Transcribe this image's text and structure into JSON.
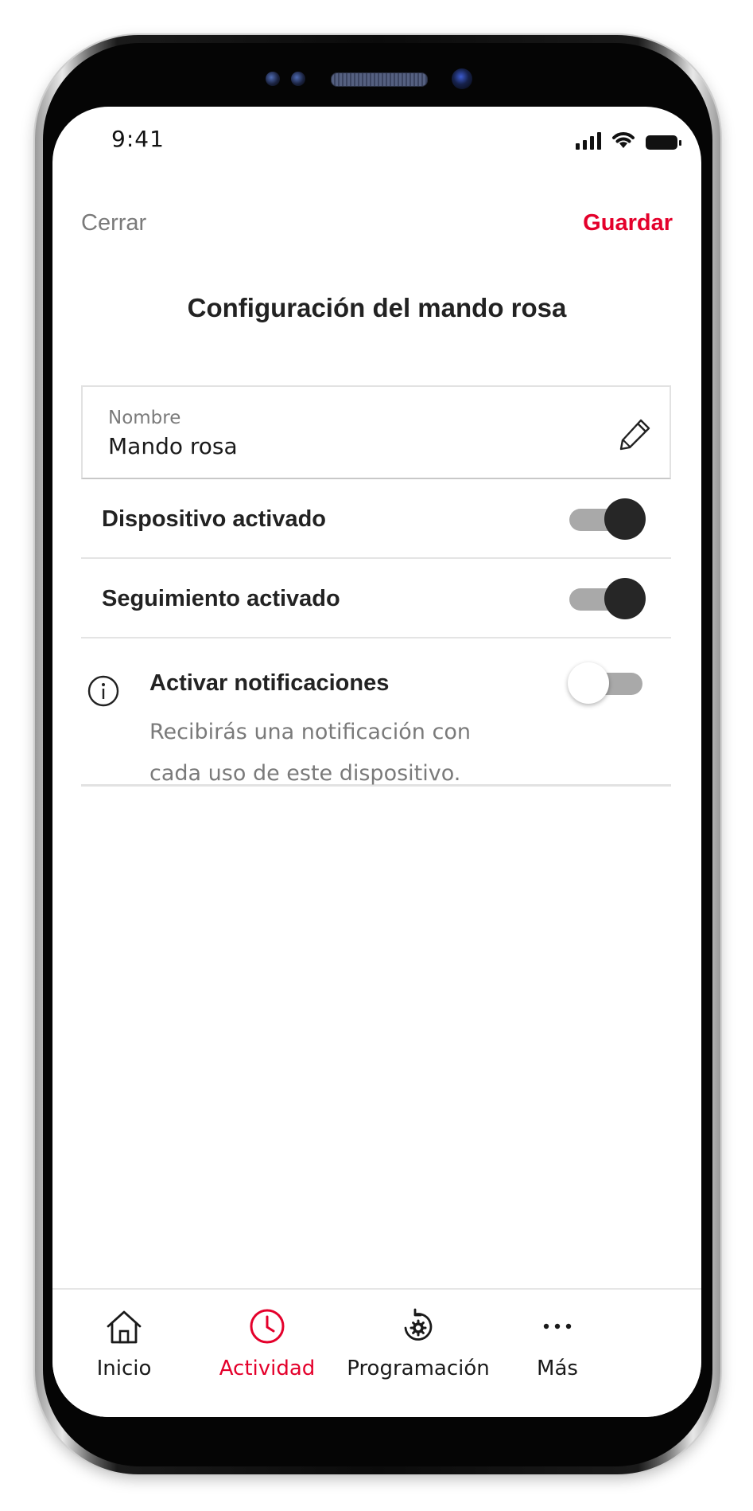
{
  "status_bar": {
    "time": "9:41"
  },
  "header": {
    "close_label": "Cerrar",
    "save_label": "Guardar",
    "title": "Configuración del mando rosa"
  },
  "name_field": {
    "label": "Nombre",
    "value": "Mando rosa"
  },
  "settings": {
    "device_enabled": {
      "label": "Dispositivo activado",
      "on": true
    },
    "tracking_enabled": {
      "label": "Seguimiento activado",
      "on": true
    },
    "notifications": {
      "title": "Activar notificaciones",
      "description": "Recibirás una notificación con cada uso de este dispositivo.",
      "on": false
    }
  },
  "tabbar": {
    "items": [
      {
        "label": "Inicio",
        "icon": "home-icon",
        "active": false
      },
      {
        "label": "Actividad",
        "icon": "clock-icon",
        "active": true
      },
      {
        "label": "Programación",
        "icon": "schedule-gear-icon",
        "active": false
      },
      {
        "label": "Más",
        "icon": "more-dots-icon",
        "active": false
      }
    ]
  },
  "colors": {
    "accent": "#e4002b",
    "text_primary": "#222222",
    "text_secondary": "#7a7a7a",
    "toggle_knob_on": "#262626",
    "toggle_track": "#a9a9a9"
  }
}
